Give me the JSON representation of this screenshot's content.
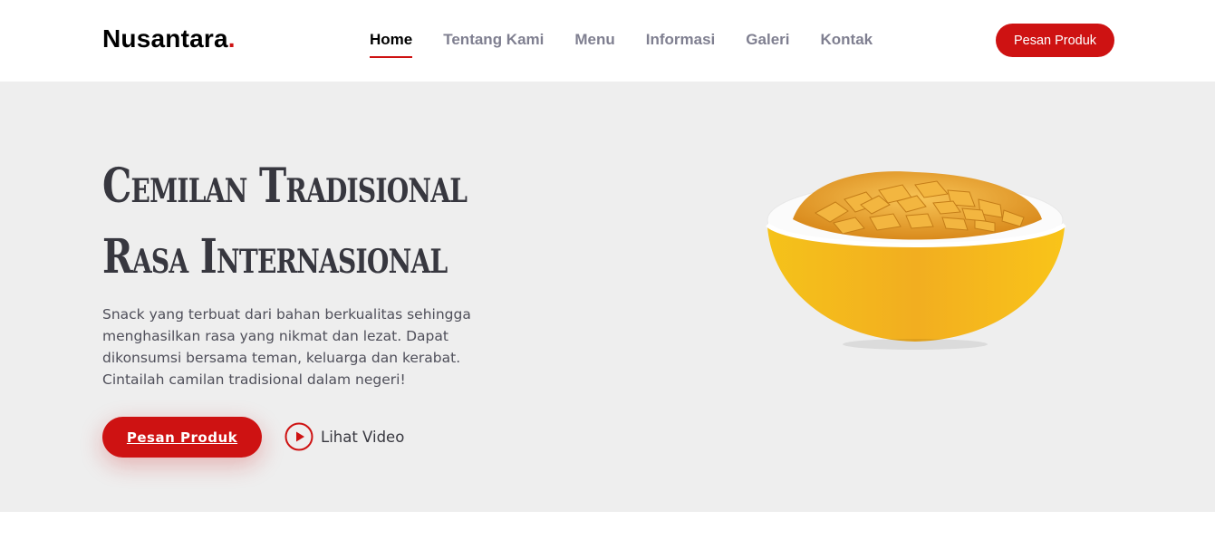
{
  "header": {
    "logo_text": "Nusantara",
    "logo_dot": ".",
    "nav": [
      {
        "label": "Home",
        "active": true
      },
      {
        "label": "Tentang Kami",
        "active": false
      },
      {
        "label": "Menu",
        "active": false
      },
      {
        "label": "Informasi",
        "active": false
      },
      {
        "label": "Galeri",
        "active": false
      },
      {
        "label": "Kontak",
        "active": false
      }
    ],
    "cta_label": "Pesan Produk"
  },
  "hero": {
    "title_line1": "Cemilan Tradisional",
    "title_line2": "Rasa Internasional",
    "description": "Snack yang terbuat dari bahan berkualitas sehingga menghasilkan rasa yang nikmat dan lezat. Dapat dikonsumsi bersama teman, keluarga dan kerabat. Cintailah camilan tradisional dalam negeri!",
    "cta_label": "Pesan Produk",
    "video_label": "Lihat Video",
    "video_icon": "play-circle-icon",
    "image_icon": "snack-bowl-image"
  },
  "colors": {
    "accent": "#ce1212",
    "hero_bg": "#eeeeee",
    "bowl": "#f5b618"
  }
}
